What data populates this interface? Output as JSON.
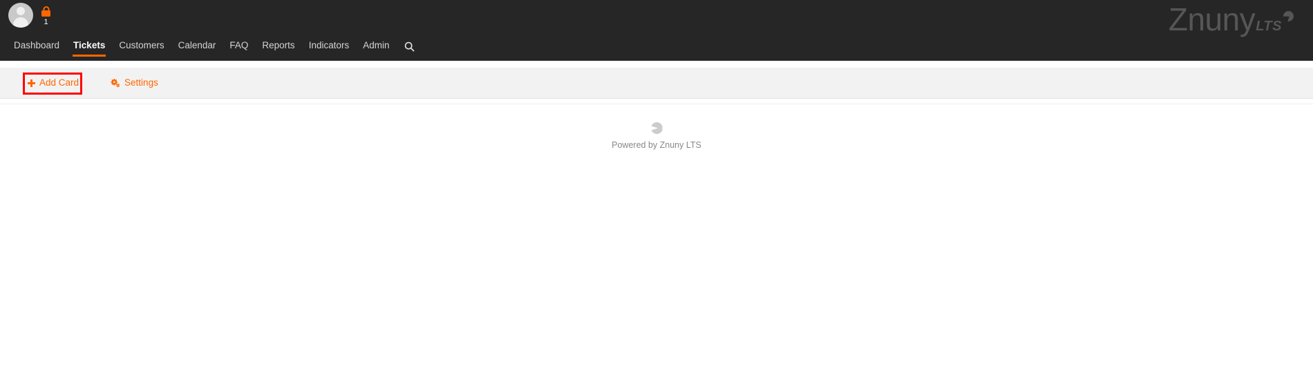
{
  "header": {
    "avatar": {
      "icon": "user-avatar-icon"
    },
    "lock": {
      "icon": "lock-icon",
      "count": "1"
    },
    "nav": [
      {
        "label": "Dashboard",
        "active": false
      },
      {
        "label": "Tickets",
        "active": true
      },
      {
        "label": "Customers",
        "active": false
      },
      {
        "label": "Calendar",
        "active": false
      },
      {
        "label": "FAQ",
        "active": false
      },
      {
        "label": "Reports",
        "active": false
      },
      {
        "label": "Indicators",
        "active": false
      },
      {
        "label": "Admin",
        "active": false
      }
    ],
    "search": {
      "icon": "search-icon"
    },
    "logo": {
      "main": "Znuny",
      "suffix": "LTS"
    }
  },
  "toolbar": {
    "add_card_label": "Add Card",
    "settings_label": "Settings"
  },
  "content": {
    "spinner": "loading-spinner",
    "powered_by": "Powered by Znuny LTS"
  },
  "colors": {
    "header_bg": "#262626",
    "accent_orange": "#ff6600",
    "toolbar_bg": "#f2f2f2",
    "highlight_red": "#ff0000",
    "logo_gray": "#565656",
    "muted_text": "#888888"
  }
}
